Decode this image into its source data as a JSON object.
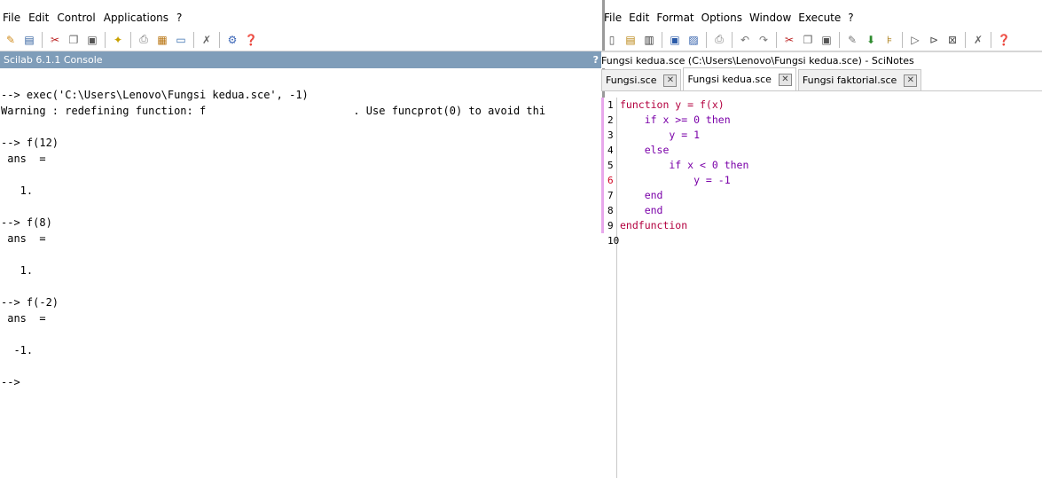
{
  "console_window": {
    "menu": [
      "File",
      "Edit",
      "Control",
      "Applications",
      "?"
    ],
    "panel_title": "Scilab 6.1.1 Console",
    "help_glyph": "?",
    "lines": [
      "--> exec('C:\\Users\\Lenovo\\Fungsi kedua.sce', -1)",
      "Warning : redefining function: f                       . Use funcprot(0) to avoid thi",
      "",
      "--> f(12)",
      " ans  =",
      "",
      "   1.",
      "",
      "--> f(8)",
      " ans  =",
      "",
      "   1.",
      "",
      "--> f(-2)",
      " ans  =",
      "",
      "  -1.",
      "",
      "-->"
    ],
    "toolbar_icons": [
      "new-script-icon",
      "open-folder-icon",
      "cut-icon",
      "copy-icon",
      "paste-icon",
      "clear-console-icon",
      "print-icon",
      "variable-browser-icon",
      "sciNotes-icon",
      "preferences-icon",
      "module-manager-icon",
      "help-icon"
    ]
  },
  "scinotes_window": {
    "menu": [
      "File",
      "Edit",
      "Format",
      "Options",
      "Window",
      "Execute",
      "?"
    ],
    "path_title": "Fungsi kedua.sce (C:\\Users\\Lenovo\\Fungsi kedua.sce) - SciNotes",
    "tabs": [
      {
        "label": "Fungsi.sce",
        "active": false
      },
      {
        "label": "Fungsi kedua.sce",
        "active": true
      },
      {
        "label": "Fungsi faktorial.sce",
        "active": false
      }
    ],
    "close_glyph": "✕",
    "line_numbers": [
      "1",
      "2",
      "3",
      "4",
      "5",
      "6",
      "7",
      "8",
      "9",
      "10"
    ],
    "code_lines": [
      "function y = f(x)",
      "    if x >= 0 then",
      "        y = 1",
      "    else",
      "        if x < 0 then",
      "            y = -1",
      "    end",
      "    end",
      "endfunction",
      ""
    ]
  }
}
